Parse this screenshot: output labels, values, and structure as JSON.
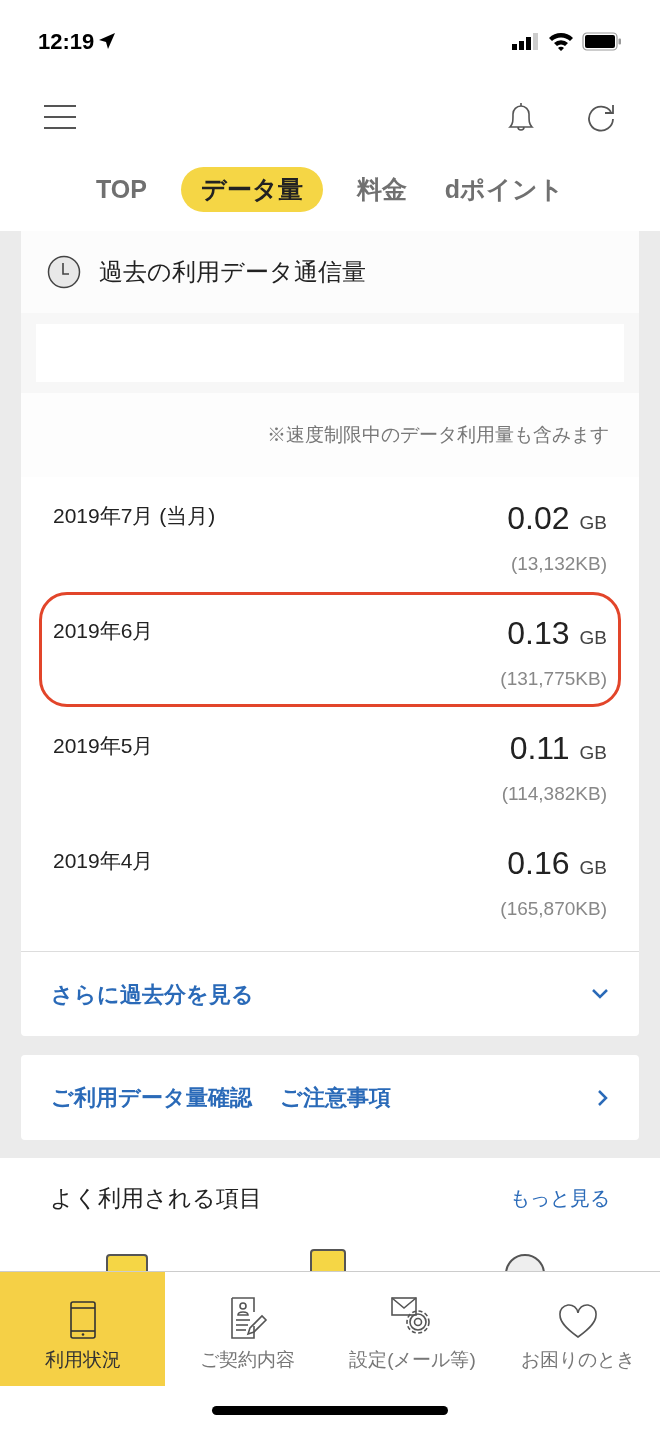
{
  "status_bar": {
    "time": "12:19"
  },
  "tabs": [
    {
      "label": "TOP",
      "selected": false
    },
    {
      "label": "データ量",
      "selected": true
    },
    {
      "label": "料金",
      "selected": false
    },
    {
      "label": "dポイント",
      "selected": false
    }
  ],
  "history": {
    "title": "過去の利用データ通信量",
    "note": "※速度制限中のデータ利用量も含みます",
    "months": [
      {
        "month": "2019年7月 (当月)",
        "value": "0.02",
        "unit": "GB",
        "kb": "(13,132KB)",
        "highlighted": false
      },
      {
        "month": "2019年6月",
        "value": "0.13",
        "unit": "GB",
        "kb": "(131,775KB)",
        "highlighted": true
      },
      {
        "month": "2019年5月",
        "value": "0.11",
        "unit": "GB",
        "kb": "(114,382KB)",
        "highlighted": false
      },
      {
        "month": "2019年4月",
        "value": "0.16",
        "unit": "GB",
        "kb": "(165,870KB)",
        "highlighted": false
      }
    ],
    "more": "さらに過去分を見る"
  },
  "notice_link": {
    "label_1": "ご利用データ量確認",
    "label_2": "ご注意事項"
  },
  "frequent": {
    "title": "よく利用される項目",
    "more": "もっと見る"
  },
  "bottom_nav": [
    {
      "label": "利用状況",
      "selected": true,
      "kind": "phone"
    },
    {
      "label": "ご契約内容",
      "selected": false,
      "kind": "contract"
    },
    {
      "label": "設定(メール等)",
      "selected": false,
      "kind": "settings"
    },
    {
      "label": "お困りのとき",
      "selected": false,
      "kind": "heart"
    }
  ]
}
